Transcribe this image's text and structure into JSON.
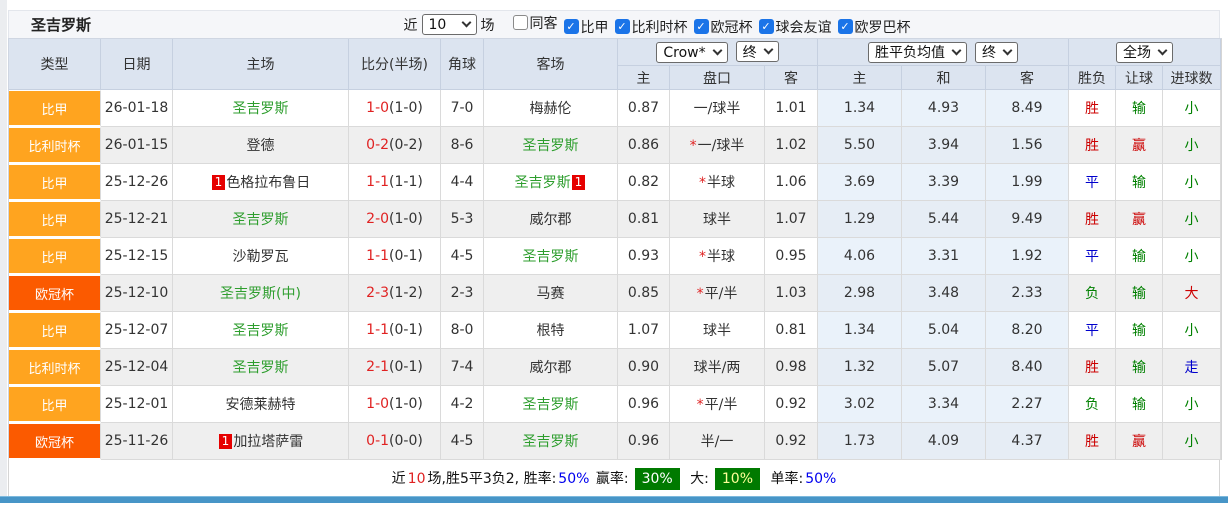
{
  "title": "圣吉罗斯",
  "filter": {
    "near_label": "近",
    "near_value": "10",
    "games_label": "场",
    "checkboxes": [
      {
        "label": "同客",
        "checked": false
      },
      {
        "label": "比甲",
        "checked": true
      },
      {
        "label": "比利时杯",
        "checked": true
      },
      {
        "label": "欧冠杯",
        "checked": true
      },
      {
        "label": "球会友谊",
        "checked": true
      },
      {
        "label": "欧罗巴杯",
        "checked": true
      }
    ]
  },
  "header": {
    "static_cols": [
      "类型",
      "日期",
      "主场",
      "比分(半场)",
      "角球",
      "客场"
    ],
    "odds_group": {
      "select1": "Crow*",
      "select2": "终",
      "cols": [
        "主",
        "盘口",
        "客"
      ]
    },
    "avg_group": {
      "select1": "胜平负均值",
      "select2": "终",
      "cols": [
        "主",
        "和",
        "客"
      ]
    },
    "result_group": {
      "select1": "全场",
      "cols": [
        "胜负",
        "让球",
        "进球数"
      ]
    }
  },
  "colors": {
    "league_orange": "#ffa41f",
    "league_euro": "#fb5a00",
    "team_green": "#2e9e2e",
    "score_red": "#e02222",
    "win_red": "#cc0000",
    "draw_blue": "#0000cc",
    "lose_green": "#008000",
    "footer_green_box": "#007a00",
    "bottom_bar_blue": "#4795c7",
    "checkbox_blue": "#1b74e8"
  },
  "rows": [
    {
      "league": "比甲",
      "league_color": "orange",
      "date": "26-01-18",
      "home": {
        "name": "圣吉罗斯",
        "green": true,
        "badge": ""
      },
      "score": {
        "ft": "1-0",
        "ht": "(1-0)"
      },
      "corners": "7-0",
      "away": {
        "name": "梅赫伦",
        "green": false,
        "badge": ""
      },
      "odds": {
        "home": "0.87",
        "star": false,
        "handicap": "一/球半",
        "away": "1.01"
      },
      "avg": {
        "home": "1.34",
        "draw": "4.93",
        "away": "8.49"
      },
      "results": {
        "outcome": {
          "text": "胜",
          "color": "red"
        },
        "handicap": {
          "text": "输",
          "color": "green"
        },
        "goals": {
          "text": "小",
          "color": "green"
        }
      }
    },
    {
      "league": "比利时杯",
      "league_color": "orange",
      "date": "26-01-15",
      "home": {
        "name": "登德",
        "green": false,
        "badge": ""
      },
      "score": {
        "ft": "0-2",
        "ht": "(0-2)"
      },
      "corners": "8-6",
      "away": {
        "name": "圣吉罗斯",
        "green": true,
        "badge": ""
      },
      "odds": {
        "home": "0.86",
        "star": true,
        "handicap": "一/球半",
        "away": "1.02"
      },
      "avg": {
        "home": "5.50",
        "draw": "3.94",
        "away": "1.56"
      },
      "results": {
        "outcome": {
          "text": "胜",
          "color": "red"
        },
        "handicap": {
          "text": "赢",
          "color": "red"
        },
        "goals": {
          "text": "小",
          "color": "green"
        }
      }
    },
    {
      "league": "比甲",
      "league_color": "orange",
      "date": "25-12-26",
      "home": {
        "name": "色格拉布鲁日",
        "green": false,
        "badge": "1"
      },
      "score": {
        "ft": "1-1",
        "ht": "(1-1)"
      },
      "corners": "4-4",
      "away": {
        "name": "圣吉罗斯",
        "green": true,
        "badge": "1"
      },
      "odds": {
        "home": "0.82",
        "star": true,
        "handicap": "半球",
        "away": "1.06"
      },
      "avg": {
        "home": "3.69",
        "draw": "3.39",
        "away": "1.99"
      },
      "results": {
        "outcome": {
          "text": "平",
          "color": "blue"
        },
        "handicap": {
          "text": "输",
          "color": "green"
        },
        "goals": {
          "text": "小",
          "color": "green"
        }
      }
    },
    {
      "league": "比甲",
      "league_color": "orange",
      "date": "25-12-21",
      "home": {
        "name": "圣吉罗斯",
        "green": true,
        "badge": ""
      },
      "score": {
        "ft": "2-0",
        "ht": "(1-0)"
      },
      "corners": "5-3",
      "away": {
        "name": "威尔郡",
        "green": false,
        "badge": ""
      },
      "odds": {
        "home": "0.81",
        "star": false,
        "handicap": "球半",
        "away": "1.07"
      },
      "avg": {
        "home": "1.29",
        "draw": "5.44",
        "away": "9.49"
      },
      "results": {
        "outcome": {
          "text": "胜",
          "color": "red"
        },
        "handicap": {
          "text": "赢",
          "color": "red"
        },
        "goals": {
          "text": "小",
          "color": "green"
        }
      }
    },
    {
      "league": "比甲",
      "league_color": "orange",
      "date": "25-12-15",
      "home": {
        "name": "沙勒罗瓦",
        "green": false,
        "badge": ""
      },
      "score": {
        "ft": "1-1",
        "ht": "(0-1)"
      },
      "corners": "4-5",
      "away": {
        "name": "圣吉罗斯",
        "green": true,
        "badge": ""
      },
      "odds": {
        "home": "0.93",
        "star": true,
        "handicap": "半球",
        "away": "0.95"
      },
      "avg": {
        "home": "4.06",
        "draw": "3.31",
        "away": "1.92"
      },
      "results": {
        "outcome": {
          "text": "平",
          "color": "blue"
        },
        "handicap": {
          "text": "输",
          "color": "green"
        },
        "goals": {
          "text": "小",
          "color": "green"
        }
      }
    },
    {
      "league": "欧冠杯",
      "league_color": "euro",
      "date": "25-12-10",
      "home": {
        "name": "圣吉罗斯(中)",
        "green": true,
        "badge": ""
      },
      "score": {
        "ft": "2-3",
        "ht": "(1-2)"
      },
      "corners": "2-3",
      "away": {
        "name": "马赛",
        "green": false,
        "badge": ""
      },
      "odds": {
        "home": "0.85",
        "star": true,
        "handicap": "平/半",
        "away": "1.03"
      },
      "avg": {
        "home": "2.98",
        "draw": "3.48",
        "away": "2.33"
      },
      "results": {
        "outcome": {
          "text": "负",
          "color": "green"
        },
        "handicap": {
          "text": "输",
          "color": "green"
        },
        "goals": {
          "text": "大",
          "color": "red"
        }
      }
    },
    {
      "league": "比甲",
      "league_color": "orange",
      "date": "25-12-07",
      "home": {
        "name": "圣吉罗斯",
        "green": true,
        "badge": ""
      },
      "score": {
        "ft": "1-1",
        "ht": "(0-1)"
      },
      "corners": "8-0",
      "away": {
        "name": "根特",
        "green": false,
        "badge": ""
      },
      "odds": {
        "home": "1.07",
        "star": false,
        "handicap": "球半",
        "away": "0.81"
      },
      "avg": {
        "home": "1.34",
        "draw": "5.04",
        "away": "8.20"
      },
      "results": {
        "outcome": {
          "text": "平",
          "color": "blue"
        },
        "handicap": {
          "text": "输",
          "color": "green"
        },
        "goals": {
          "text": "小",
          "color": "green"
        }
      }
    },
    {
      "league": "比利时杯",
      "league_color": "orange",
      "date": "25-12-04",
      "home": {
        "name": "圣吉罗斯",
        "green": true,
        "badge": ""
      },
      "score": {
        "ft": "2-1",
        "ht": "(0-1)"
      },
      "corners": "7-4",
      "away": {
        "name": "威尔郡",
        "green": false,
        "badge": ""
      },
      "odds": {
        "home": "0.90",
        "star": false,
        "handicap": "球半/两",
        "away": "0.98"
      },
      "avg": {
        "home": "1.32",
        "draw": "5.07",
        "away": "8.40"
      },
      "results": {
        "outcome": {
          "text": "胜",
          "color": "red"
        },
        "handicap": {
          "text": "输",
          "color": "green"
        },
        "goals": {
          "text": "走",
          "color": "blue"
        }
      }
    },
    {
      "league": "比甲",
      "league_color": "orange",
      "date": "25-12-01",
      "home": {
        "name": "安德莱赫特",
        "green": false,
        "badge": ""
      },
      "score": {
        "ft": "1-0",
        "ht": "(1-0)"
      },
      "corners": "4-2",
      "away": {
        "name": "圣吉罗斯",
        "green": true,
        "badge": ""
      },
      "odds": {
        "home": "0.96",
        "star": true,
        "handicap": "平/半",
        "away": "0.92"
      },
      "avg": {
        "home": "3.02",
        "draw": "3.34",
        "away": "2.27"
      },
      "results": {
        "outcome": {
          "text": "负",
          "color": "green"
        },
        "handicap": {
          "text": "输",
          "color": "green"
        },
        "goals": {
          "text": "小",
          "color": "green"
        }
      }
    },
    {
      "league": "欧冠杯",
      "league_color": "euro",
      "date": "25-11-26",
      "home": {
        "name": "加拉塔萨雷",
        "green": false,
        "badge": "1"
      },
      "score": {
        "ft": "0-1",
        "ht": "(0-0)"
      },
      "corners": "4-5",
      "away": {
        "name": "圣吉罗斯",
        "green": true,
        "badge": ""
      },
      "odds": {
        "home": "0.96",
        "star": false,
        "handicap": "半/一",
        "away": "0.92"
      },
      "avg": {
        "home": "1.73",
        "draw": "4.09",
        "away": "4.37"
      },
      "results": {
        "outcome": {
          "text": "胜",
          "color": "red"
        },
        "handicap": {
          "text": "赢",
          "color": "red"
        },
        "goals": {
          "text": "小",
          "color": "green"
        }
      }
    }
  ],
  "footer": {
    "segments": [
      {
        "text": "近",
        "style": "plain"
      },
      {
        "text": "10",
        "style": "red"
      },
      {
        "text": "场,胜5平3负2, 胜率:",
        "style": "plain"
      },
      {
        "text": "50%",
        "style": "blue"
      },
      {
        "text": " 赢率:",
        "style": "plain"
      },
      {
        "text": "30%",
        "style": "greenbox"
      },
      {
        "text": " 大:",
        "style": "plain"
      },
      {
        "text": "10%",
        "style": "greenbox-yellow"
      },
      {
        "text": " 单率:",
        "style": "plain"
      },
      {
        "text": "50%",
        "style": "blue"
      }
    ]
  }
}
